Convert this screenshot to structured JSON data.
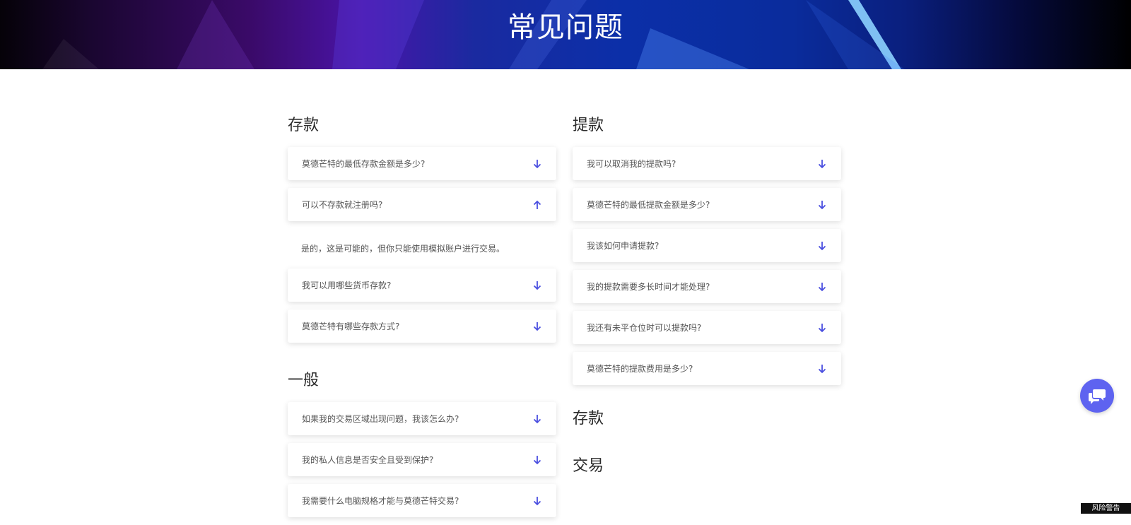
{
  "hero": {
    "title": "常见问题"
  },
  "left_column": {
    "sections": [
      {
        "title": "存款",
        "items": [
          {
            "question": "莫德芒特的最低存款金额是多少?",
            "expanded": false
          },
          {
            "question": "可以不存款就注册吗?",
            "expanded": true,
            "answer": "是的，这是可能的，但你只能使用模拟账户进行交易。"
          },
          {
            "question": "我可以用哪些货币存款?",
            "expanded": false
          },
          {
            "question": "莫德芒特有哪些存款方式?",
            "expanded": false
          }
        ]
      },
      {
        "title": "一般",
        "items": [
          {
            "question": "如果我的交易区域出现问题，我该怎么办?",
            "expanded": false
          },
          {
            "question": "我的私人信息是否安全且受到保护?",
            "expanded": false
          },
          {
            "question": "我需要什么电脑规格才能与莫德芒特交易?",
            "expanded": false
          }
        ]
      }
    ]
  },
  "right_column": {
    "sections": [
      {
        "title": "提款",
        "items": [
          {
            "question": "我可以取消我的提款吗?",
            "expanded": false
          },
          {
            "question": "莫德芒特的最低提款金额是多少?",
            "expanded": false
          },
          {
            "question": "我该如何申请提款?",
            "expanded": false
          },
          {
            "question": "我的提款需要多长时间才能处理?",
            "expanded": false
          },
          {
            "question": "我还有未平仓位时可以提款吗?",
            "expanded": false
          },
          {
            "question": "莫德芒特的提款费用是多少?",
            "expanded": false
          }
        ]
      },
      {
        "title": "存款",
        "items": []
      },
      {
        "title": "交易",
        "items": []
      }
    ]
  },
  "chat": {
    "icon": "chat-bubbles-icon"
  },
  "risk_warning": {
    "label": "风险警告"
  },
  "colors": {
    "accent": "#5e63f0",
    "arrow": "#4a4fe0",
    "text": "#555555",
    "heading": "#2b2b2b"
  }
}
